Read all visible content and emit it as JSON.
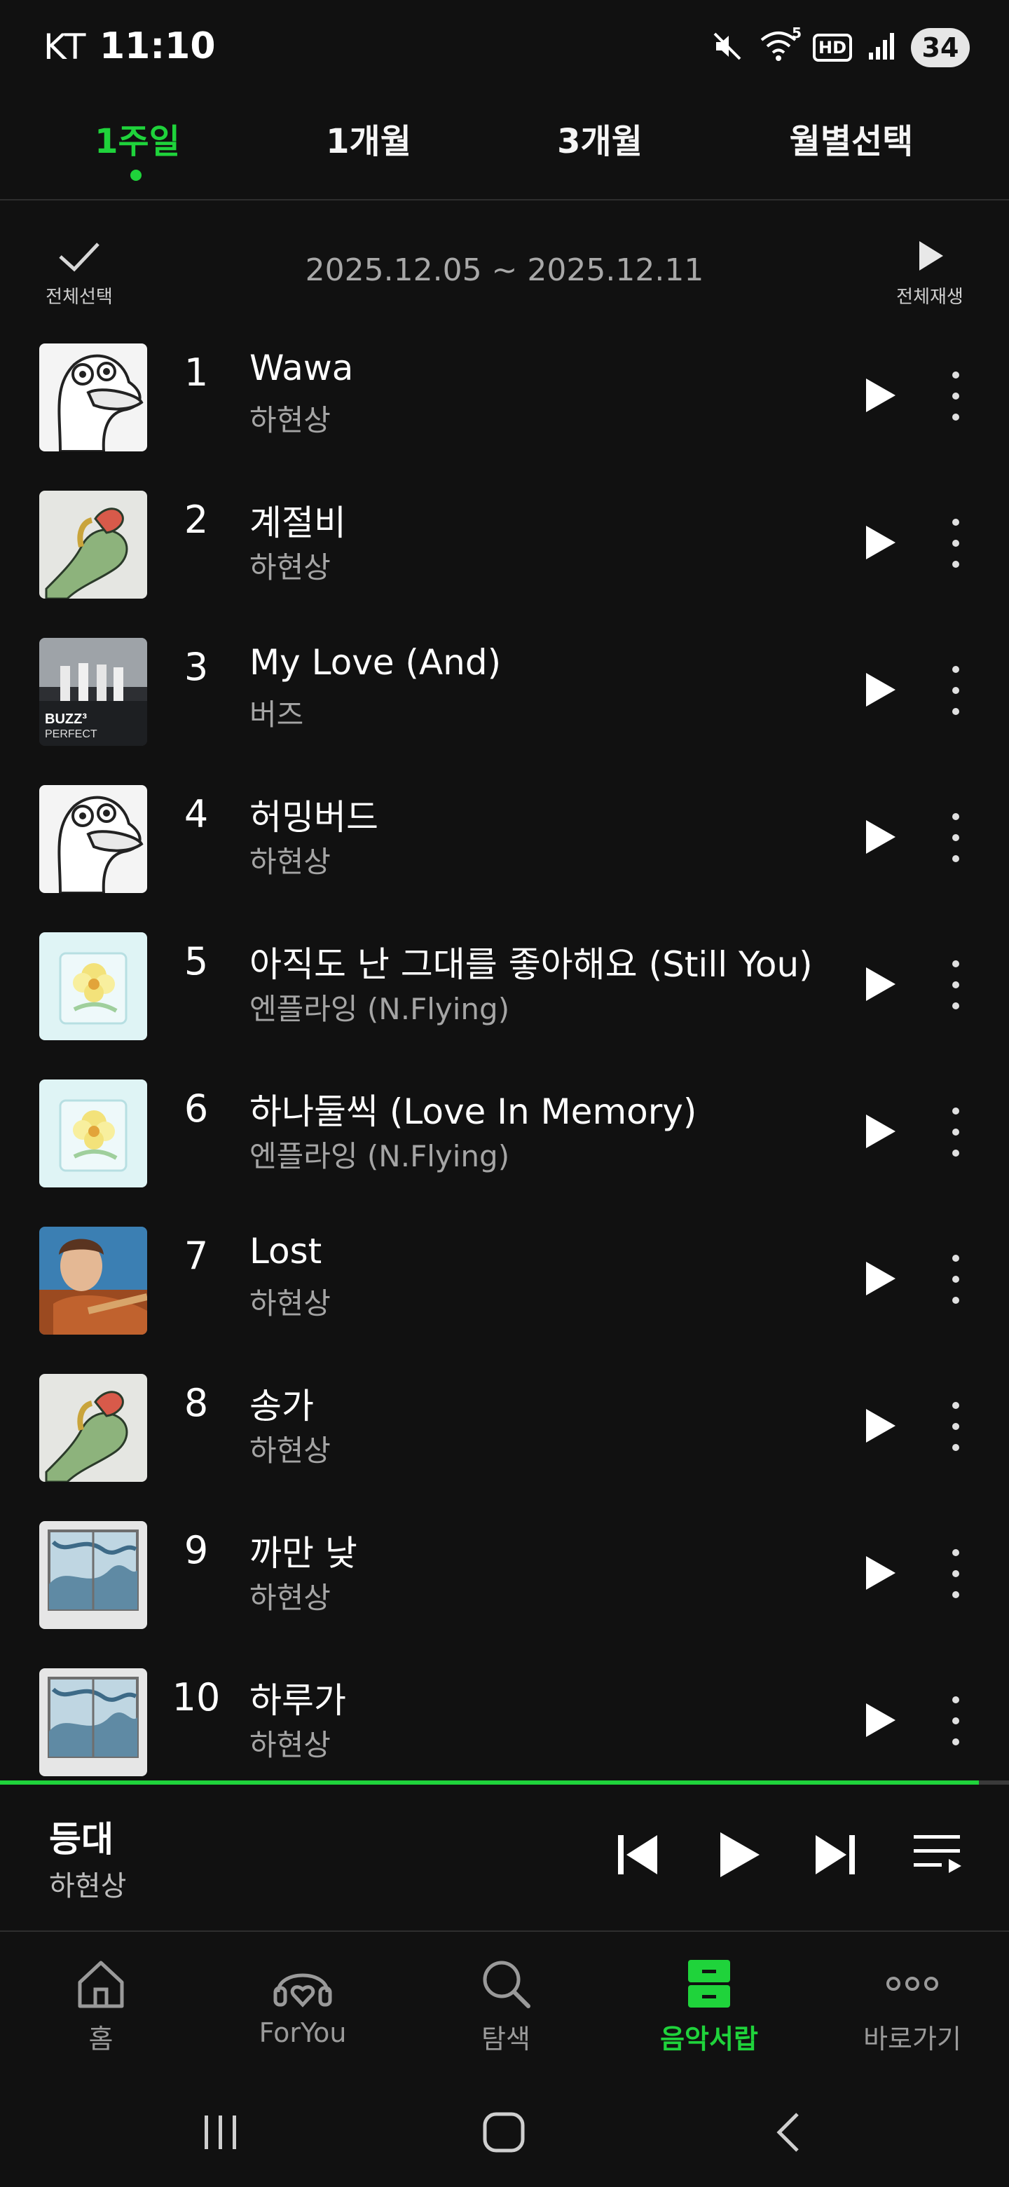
{
  "status_bar": {
    "carrier": "KT",
    "time": "11:10",
    "battery": "34",
    "hd_label": "HD",
    "wifi_badge": "5"
  },
  "tabs": [
    {
      "label": "1주일",
      "active": true
    },
    {
      "label": "1개월",
      "active": false
    },
    {
      "label": "3개월",
      "active": false
    },
    {
      "label": "월별선택",
      "active": false
    }
  ],
  "controls": {
    "select_all_label": "전체선택",
    "date_range": "2025.12.05 ~ 2025.12.11",
    "play_all_label": "전체재생"
  },
  "tracks": [
    {
      "rank": "1",
      "title": "Wawa",
      "artist": "하현상",
      "cover": "duck"
    },
    {
      "rank": "2",
      "title": "계절비",
      "artist": "하현상",
      "cover": "hand"
    },
    {
      "rank": "3",
      "title": "My Love (And)",
      "artist": "버즈",
      "cover": "buzz",
      "cover_text": "BUZZ³ PERFECT"
    },
    {
      "rank": "4",
      "title": "허밍버드",
      "artist": "하현상",
      "cover": "duck"
    },
    {
      "rank": "5",
      "title": "아직도 난 그대를 좋아해요 (Still You)",
      "artist": "엔플라잉 (N.Flying)",
      "cover": "flower"
    },
    {
      "rank": "6",
      "title": "하나둘씩 (Love In Memory)",
      "artist": "엔플라잉 (N.Flying)",
      "cover": "flower"
    },
    {
      "rank": "7",
      "title": "Lost",
      "artist": "하현상",
      "cover": "portrait"
    },
    {
      "rank": "8",
      "title": "송가",
      "artist": "하현상",
      "cover": "hand"
    },
    {
      "rank": "9",
      "title": "까만 낮",
      "artist": "하현상",
      "cover": "window"
    },
    {
      "rank": "10",
      "title": "하루가",
      "artist": "하현상",
      "cover": "window"
    }
  ],
  "now_playing": {
    "title": "등대",
    "artist": "하현상",
    "progress": 0.97
  },
  "bottom_nav": [
    {
      "label": "홈",
      "icon": "home-icon",
      "active": false
    },
    {
      "label": "ForYou",
      "icon": "headphones-heart-icon",
      "active": false
    },
    {
      "label": "탐색",
      "icon": "search-icon",
      "active": false
    },
    {
      "label": "음악서랍",
      "icon": "drawer-icon",
      "active": true
    },
    {
      "label": "바로가기",
      "icon": "more-dots-icon",
      "active": false
    }
  ],
  "colors": {
    "accent": "#1fd33b",
    "background": "#111111",
    "secondary_text": "#a5a5a5"
  }
}
